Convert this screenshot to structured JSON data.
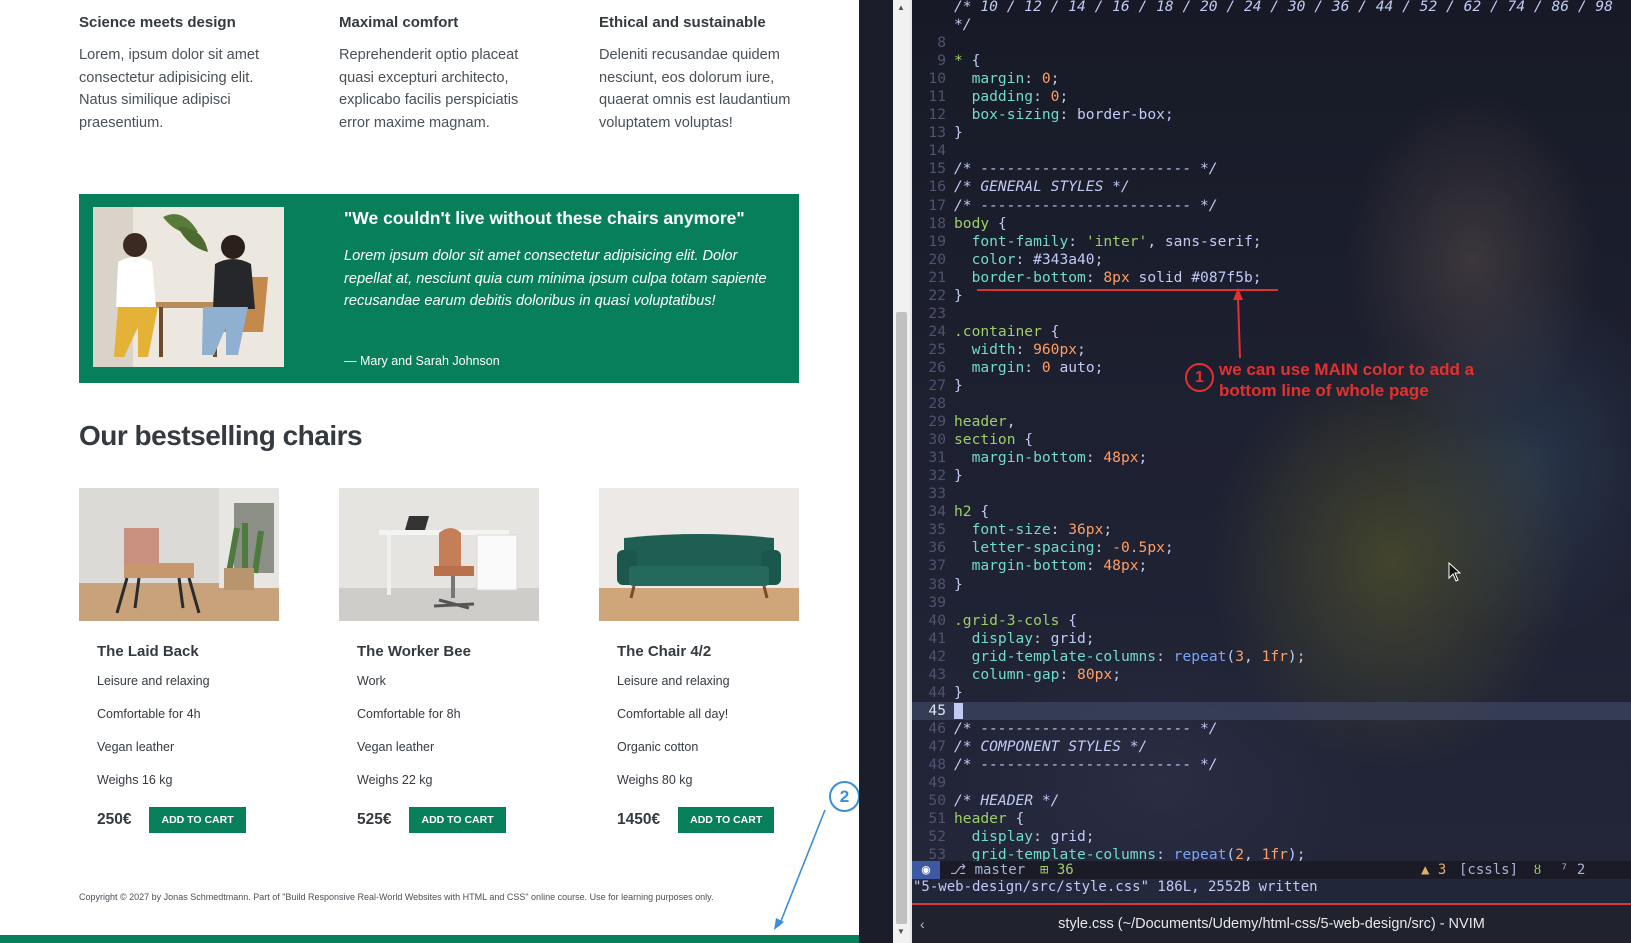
{
  "features": [
    {
      "title": "Science meets design",
      "text": "Lorem, ipsum dolor sit amet consectetur adipisicing elit. Natus similique adipisci praesentium."
    },
    {
      "title": "Maximal comfort",
      "text": "Reprehenderit optio placeat quasi excepturi architecto, explicabo facilis perspiciatis error maxime magnam."
    },
    {
      "title": "Ethical and sustainable",
      "text": "Deleniti recusandae quidem nesciunt, eos dolorum iure, quaerat omnis est laudantium voluptatem voluptas!"
    }
  ],
  "testimonial": {
    "quote": "\"We couldn't live without these chairs anymore\"",
    "text": "Lorem ipsum dolor sit amet consectetur adipisicing elit. Dolor repellat at, nesciunt quia cum minima ipsum culpa totam sapiente recusandae earum debitis doloribus in quasi voluptatibus!",
    "author": "— Mary and Sarah Johnson"
  },
  "chairs_title": "Our bestselling chairs",
  "chairs": [
    {
      "name": "The Laid Back",
      "features": [
        "Leisure and relaxing",
        "Comfortable for 4h",
        "Vegan leather",
        "Weighs 16 kg"
      ],
      "price": "250€",
      "button": "ADD TO CART"
    },
    {
      "name": "The Worker Bee",
      "features": [
        "Work",
        "Comfortable for 8h",
        "Vegan leather",
        "Weighs 22 kg"
      ],
      "price": "525€",
      "button": "ADD TO CART"
    },
    {
      "name": "The Chair 4/2",
      "features": [
        "Leisure and relaxing",
        "Comfortable all day!",
        "Organic cotton",
        "Weighs 80 kg"
      ],
      "price": "1450€",
      "button": "ADD TO CART"
    }
  ],
  "copyright": "Copyright © 2027 by Jonas Schmedtmann. Part of \"Build Responsive Real-World Websites with HTML and CSS\" online course. Use for learning purposes only.",
  "annotations": {
    "one_number": "1",
    "one_line1": "we can use MAIN color to add a",
    "one_line2": "bottom line of whole page",
    "two_number": "2"
  },
  "colors": {
    "brand_green": "#087f5b",
    "annotation_red": "#e53030",
    "annotation_blue": "#3c8ed8"
  },
  "editor": {
    "statusline": {
      "mode_icon": "◉",
      "branch": "master",
      "additions": "⊞ 36",
      "warnings": "▲ 3",
      "filetype": "[cssls]",
      "lsp_icon": "ȣ",
      "position": "⁷ 2"
    },
    "cmdline": "\"5-web-design/src/style.css\" 186L, 2552B written",
    "window_title": "style.css (~/Documents/Udemy/html-css/5-web-design/src) - NVIM",
    "back_icon": "‹"
  }
}
